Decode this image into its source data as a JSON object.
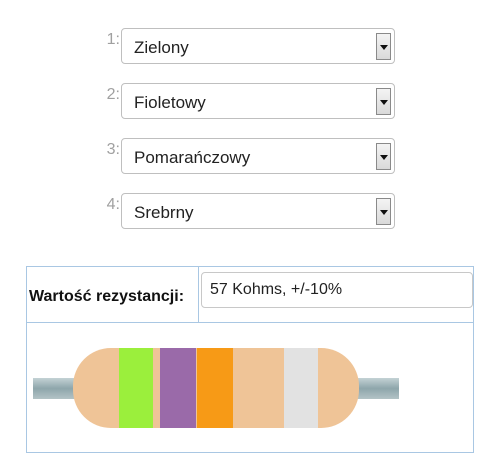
{
  "bands": [
    {
      "number": "1:",
      "value": "Zielony",
      "color": "#9bef3c"
    },
    {
      "number": "2:",
      "value": "Fioletowy",
      "color": "#9a6aa9"
    },
    {
      "number": "3:",
      "value": "Pomarańczowy",
      "color": "#f79a16"
    },
    {
      "number": "4:",
      "value": "Srebrny",
      "color": "#e2e2e2"
    }
  ],
  "result": {
    "label": "Wartość rezystancji:",
    "value": "57 Kohms, +/-10%"
  },
  "resistor": {
    "body_color": "#efc497",
    "lead_color": "#9ab0b5"
  }
}
